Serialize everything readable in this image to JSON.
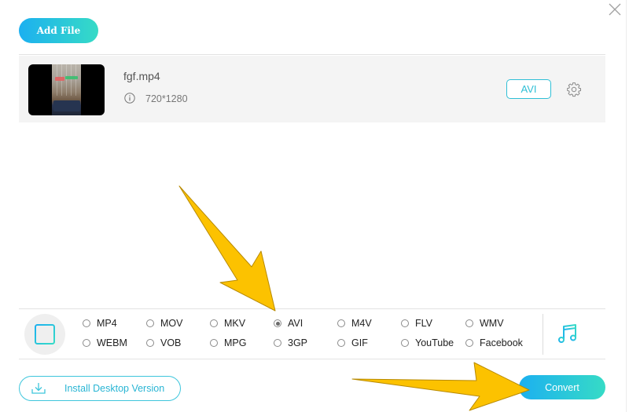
{
  "header": {
    "add_file_label": "Add File",
    "close_icon": "close-x-icon"
  },
  "file": {
    "name": "fgf.mp4",
    "resolution": "720*1280",
    "output_format": "AVI",
    "info_icon": "info-circle-icon",
    "settings_icon": "gear-icon"
  },
  "formats": {
    "video_tab_icon": "film-icon",
    "audio_tab_icon": "music-note-icon",
    "selected": "AVI",
    "options": [
      {
        "label": "MP4",
        "checked": false
      },
      {
        "label": "MOV",
        "checked": false
      },
      {
        "label": "MKV",
        "checked": false
      },
      {
        "label": "AVI",
        "checked": true
      },
      {
        "label": "M4V",
        "checked": false
      },
      {
        "label": "FLV",
        "checked": false
      },
      {
        "label": "WMV",
        "checked": false
      },
      {
        "label": "WEBM",
        "checked": false
      },
      {
        "label": "VOB",
        "checked": false
      },
      {
        "label": "MPG",
        "checked": false
      },
      {
        "label": "3GP",
        "checked": false
      },
      {
        "label": "GIF",
        "checked": false
      },
      {
        "label": "YouTube",
        "checked": false
      },
      {
        "label": "Facebook",
        "checked": false
      }
    ]
  },
  "footer": {
    "install_label": "Install Desktop Version",
    "install_icon": "download-icon",
    "convert_label": "Convert"
  },
  "colors": {
    "accent_start": "#1cb0f0",
    "accent_end": "#36dbc6",
    "annotation_arrow": "#fcc200"
  }
}
